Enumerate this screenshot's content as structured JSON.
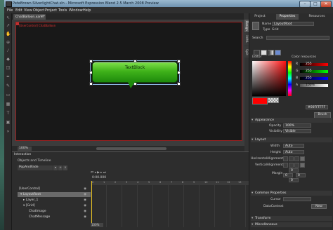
{
  "window": {
    "title": "PeteBrown.SilverlightChat.sln - Microsoft Expression Blend 2.5 March 2008 Preview",
    "minimize_label": "–",
    "maximize_label": "□",
    "close_label": "✕"
  },
  "menu": [
    "File",
    "Edit",
    "View",
    "Object",
    "Project",
    "Tools",
    "Window",
    "Help"
  ],
  "document": {
    "tab_label": "ChatBalloon.xaml*",
    "tab_close": "×",
    "breadcrumb": "[UserControl] ChatBalloon",
    "view_tabs": [
      "Design",
      "XAML",
      "Split"
    ],
    "bubble_text": "TextBlock",
    "zoom": "100%"
  },
  "interaction": {
    "panel_title": "Interaction",
    "objects_title": "Objects and Timeline",
    "storyboard": "PopAndFade",
    "timecode": "0:00.000",
    "ruler_ticks": [
      "0",
      "1",
      "2",
      "3",
      "4",
      "5",
      "6",
      "7",
      "8",
      "9",
      "10",
      "11",
      "12",
      "13"
    ],
    "tree": [
      {
        "label": "[UserControl]",
        "indent": 0,
        "selected": false
      },
      {
        "label": "▾ LayoutRoot",
        "indent": 2,
        "selected": true
      },
      {
        "label": "▸ Layer_1",
        "indent": 6,
        "selected": false
      },
      {
        "label": "▾ [Grid]",
        "indent": 6,
        "selected": false
      },
      {
        "label": "ChatImage",
        "indent": 14,
        "selected": false
      },
      {
        "label": "ChatMessage",
        "indent": 14,
        "selected": false
      }
    ],
    "zoom": "100%"
  },
  "panel": {
    "tabs": [
      "Project",
      "Properties",
      "Resources"
    ],
    "name_label": "Name",
    "name_value": "LayoutRoot",
    "type_label": "Type",
    "type_value": "Grid",
    "search_label": "Search",
    "editor_label": "Editor",
    "color_resources_label": "Color resources",
    "channels": [
      {
        "label": "R",
        "value": "255"
      },
      {
        "label": "G",
        "value": "255"
      },
      {
        "label": "B",
        "value": "255"
      },
      {
        "label": "A",
        "value": "100%"
      }
    ],
    "hex_value": "#00FFFFFF",
    "brush_button": "Brush",
    "sections": {
      "appearance": "Appearance",
      "layout": "Layout",
      "common": "Common Properties",
      "transform": "Transform",
      "misc": "Miscellaneous"
    },
    "opacity_label": "Opacity",
    "opacity_value": "100%",
    "visibility_label": "Visibility",
    "visibility_value": "Visible",
    "width_label": "Width",
    "width_value": "Auto",
    "height_label": "Height",
    "height_value": "Auto",
    "halign_label": "HorizontalAlignment",
    "valign_label": "VerticalAlignment",
    "margin_label": "Margin",
    "margin_values": [
      "0",
      "0",
      "0",
      "0"
    ],
    "cursor_label": "Cursor",
    "datacontext_label": "DataContext",
    "new_button": "New"
  }
}
